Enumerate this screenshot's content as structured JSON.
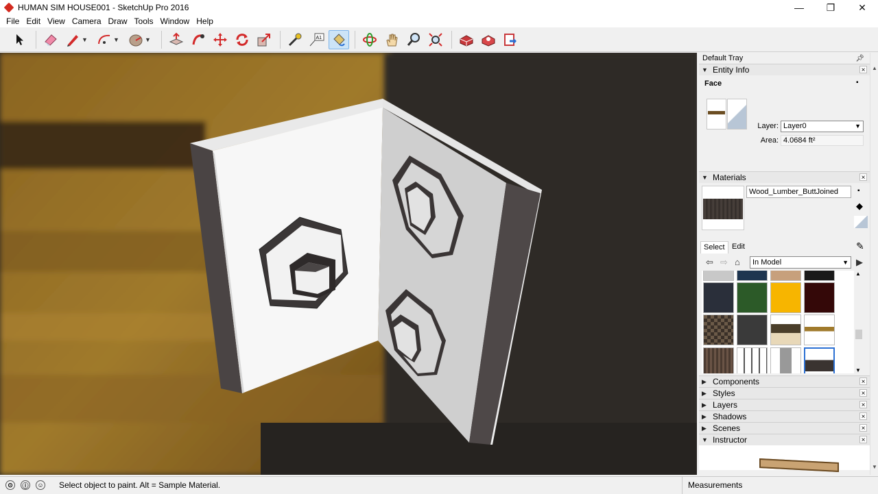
{
  "window": {
    "title": "HUMAN SIM HOUSE001 - SketchUp Pro 2016",
    "controls": [
      "—",
      "❐",
      "✕"
    ]
  },
  "menu": [
    "File",
    "Edit",
    "View",
    "Camera",
    "Draw",
    "Tools",
    "Window",
    "Help"
  ],
  "toolbar": {
    "tools": [
      "select-tool",
      "eraser-tool",
      "line-tool",
      "arc-tool",
      "shapes-tool",
      "push-pull-tool",
      "follow-me-tool",
      "move-tool",
      "rotate-tool",
      "scale-tool",
      "tape-measure-tool",
      "text-tool",
      "paint-bucket-tool",
      "orbit-tool",
      "pan-tool",
      "zoom-tool",
      "zoom-extents-tool",
      "warehouse-tool",
      "extension-warehouse-tool",
      "send-to-layout-tool"
    ],
    "active_tool": "paint-bucket-tool",
    "text_tool_label": "A1"
  },
  "tray": {
    "title": "Default Tray",
    "entity_info": {
      "heading": "Entity Info",
      "type": "Face",
      "layer_label": "Layer:",
      "layer_value": "Layer0",
      "area_label": "Area:",
      "area_value": "4.0684 ft²"
    },
    "materials": {
      "heading": "Materials",
      "current_name": "Wood_Lumber_ButtJoined",
      "tabs": [
        "Select",
        "Edit"
      ],
      "library": "In Model",
      "swatches": [
        "#c8c8c8",
        "#1e3550",
        "#c7a07c",
        "#1a1a1a",
        "#2a2f3a",
        "#2c5a28",
        "#f7b500",
        "#340808",
        "checker",
        "#3a3a3a",
        "wood-light",
        "wood-beam",
        "wood-dark",
        "window",
        "door",
        "lumber-selected"
      ]
    },
    "collapsed_panels": [
      "Components",
      "Styles",
      "Layers",
      "Shadows",
      "Scenes",
      "Instructor"
    ]
  },
  "status": {
    "message": "Select object to paint. Alt = Sample Material.",
    "measurements_label": "Measurements"
  },
  "colors": {
    "accent": "#7eb4ea",
    "viewport_bg": "#2d2822"
  }
}
